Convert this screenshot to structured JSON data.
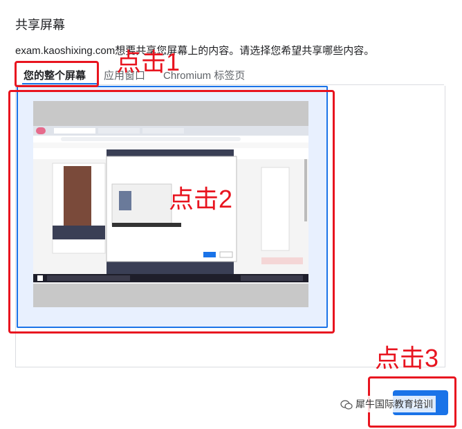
{
  "dialog": {
    "title": "共享屏幕",
    "description": "exam.kaoshixing.com想要共享您屏幕上的内容。请选择您希望共享哪些内容。",
    "tabs": [
      {
        "label": "您的整个屏幕",
        "active": true
      },
      {
        "label": "应用窗口",
        "active": false
      },
      {
        "label": "Chromium 标签页",
        "active": false
      }
    ],
    "share_button_label": "分享"
  },
  "annotations": {
    "step1": "点击1",
    "step2": "点击2",
    "step3": "点击3",
    "color": "#e8141f"
  },
  "watermark": {
    "text": "犀牛国际教育培训"
  },
  "colors": {
    "accent": "#1a73e8",
    "annotation": "#e8141f",
    "thumbnail_bg": "#c8c8c8"
  }
}
